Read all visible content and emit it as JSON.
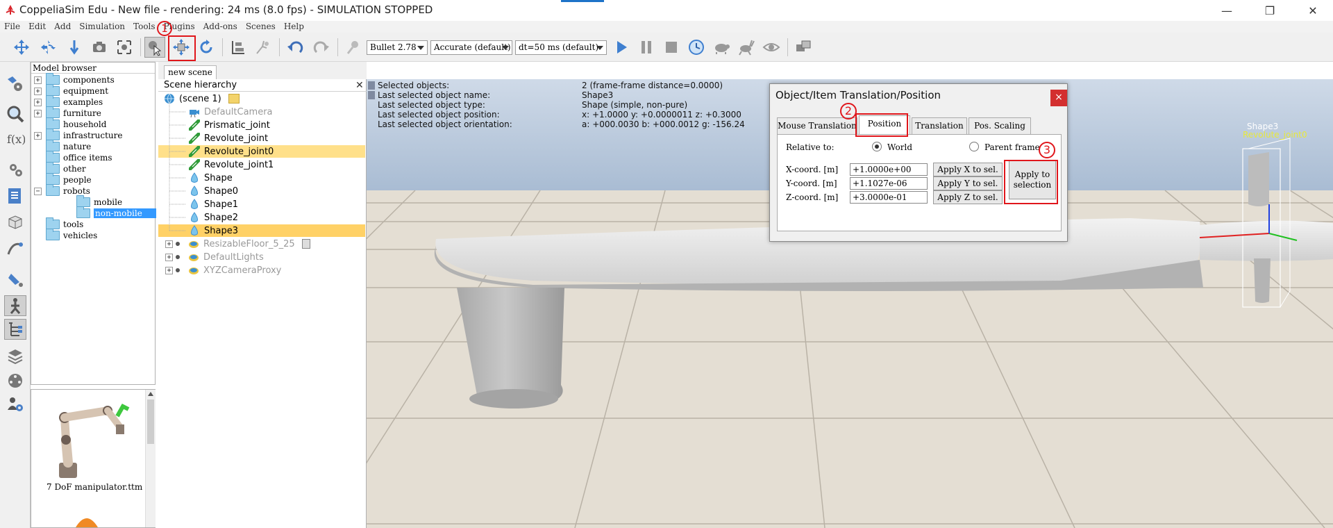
{
  "window": {
    "title": "CoppeliaSim Edu - New file - rendering: 24 ms (8.0 fps) - SIMULATION STOPPED",
    "minimize": "—",
    "restore": "❐",
    "close": "✕",
    "accent_color": "#1e73c8"
  },
  "menu": [
    "File",
    "Edit",
    "Add",
    "Simulation",
    "Tools",
    "Plugins",
    "Add-ons",
    "Scenes",
    "Help"
  ],
  "toolbar": {
    "engine": "Bullet 2.78",
    "accuracy": "Accurate (default)",
    "timestep": "dt=50 ms (default)",
    "buttons": [
      "camera-pan-icon",
      "camera-rotate-icon",
      "camera-shift-icon",
      "camera-fit-icon",
      "camera-view-icon",
      "click-select-icon",
      "object-shift-icon",
      "object-rotate-icon",
      "assemble-icon",
      "transfer-dna-icon",
      "undo-icon",
      "redo-icon",
      "engine-icon",
      "play-icon",
      "pause-icon",
      "stop-icon",
      "realtime-icon",
      "slow-down-icon",
      "speed-up-icon",
      "visualization-icon",
      "page-selector-icon"
    ]
  },
  "model_browser": {
    "header": "Model browser",
    "items": [
      {
        "label": "components",
        "expander": "+",
        "level": 0
      },
      {
        "label": "equipment",
        "expander": "+",
        "level": 0
      },
      {
        "label": "examples",
        "expander": "+",
        "level": 0
      },
      {
        "label": "furniture",
        "expander": "+",
        "level": 0
      },
      {
        "label": "household",
        "expander": "",
        "level": 0
      },
      {
        "label": "infrastructure",
        "expander": "+",
        "level": 0
      },
      {
        "label": "nature",
        "expander": "",
        "level": 0
      },
      {
        "label": "office items",
        "expander": "",
        "level": 0
      },
      {
        "label": "other",
        "expander": "",
        "level": 0
      },
      {
        "label": "people",
        "expander": "",
        "level": 0
      },
      {
        "label": "robots",
        "expander": "−",
        "level": 0
      },
      {
        "label": "mobile",
        "expander": "",
        "level": 1
      },
      {
        "label": "non-mobile",
        "expander": "",
        "level": 1,
        "selected": true
      },
      {
        "label": "tools",
        "expander": "",
        "level": 0
      },
      {
        "label": "vehicles",
        "expander": "",
        "level": 0
      }
    ],
    "thumbnail_label": "7 DoF manipulator.ttm"
  },
  "scene_tab": "new scene",
  "hierarchy": {
    "header": "Scene hierarchy",
    "close": "✕",
    "items": [
      {
        "label": "(scene 1)",
        "icon": "globe-icon",
        "state": "normal"
      },
      {
        "label": "DefaultCamera",
        "icon": "camera-icon",
        "state": "dim"
      },
      {
        "label": "Prismatic_joint",
        "icon": "joint-icon",
        "state": "normal"
      },
      {
        "label": "Revolute_joint",
        "icon": "joint-icon",
        "state": "normal"
      },
      {
        "label": "Revolute_joint0",
        "icon": "joint-icon",
        "state": "hl1"
      },
      {
        "label": "Revolute_joint1",
        "icon": "joint-icon",
        "state": "normal"
      },
      {
        "label": "Shape",
        "icon": "shape-icon",
        "state": "normal"
      },
      {
        "label": "Shape0",
        "icon": "shape-icon",
        "state": "normal"
      },
      {
        "label": "Shape1",
        "icon": "shape-icon",
        "state": "normal"
      },
      {
        "label": "Shape2",
        "icon": "shape-icon",
        "state": "normal"
      },
      {
        "label": "Shape3",
        "icon": "shape-icon",
        "state": "hl2"
      },
      {
        "label": "ResizableFloor_5_25",
        "icon": "model-icon",
        "state": "dim"
      },
      {
        "label": "DefaultLights",
        "icon": "model-icon",
        "state": "dim"
      },
      {
        "label": "XYZCameraProxy",
        "icon": "model-icon",
        "state": "dim"
      }
    ]
  },
  "info_overlay": [
    {
      "key": "Selected objects:",
      "value": "2 (frame-frame distance=0.0000)"
    },
    {
      "key": "Last selected object name:",
      "value": "Shape3"
    },
    {
      "key": "Last selected object type:",
      "value": "Shape (simple, non-pure)"
    },
    {
      "key": "Last selected object position:",
      "value": "x: +1.0000    y: +0.0000011    z: +0.3000"
    },
    {
      "key": "Last selected object orientation:",
      "value": "a: +000.0030    b: +000.0012    g: -156.24"
    }
  ],
  "scene_labels": {
    "shape": "Shape3",
    "joint": "Revolute_joint0"
  },
  "dialog": {
    "title": "Object/Item Translation/Position",
    "close": "×",
    "tabs": [
      "Mouse Translation",
      "Position",
      "Translation",
      "Pos. Scaling"
    ],
    "active_tab": "Position",
    "relative_to": "Relative to:",
    "world": "World",
    "parent_frame": "Parent frame",
    "rows": [
      {
        "label": "X-coord. [m]",
        "value": "+1.0000e+00",
        "button": "Apply X to sel."
      },
      {
        "label": "Y-coord. [m]",
        "value": "+1.1027e-06",
        "button": "Apply Y to sel."
      },
      {
        "label": "Z-coord. [m]",
        "value": "+3.0000e-01",
        "button": "Apply Z to sel."
      }
    ],
    "apply_line1": "Apply to",
    "apply_line2": "selection"
  },
  "callouts": [
    "1",
    "2",
    "3"
  ],
  "colors": {
    "callout": "#e0161b",
    "selection": "#3399ff",
    "highlight1": "#ffe08a",
    "highlight2": "#ffd166"
  }
}
